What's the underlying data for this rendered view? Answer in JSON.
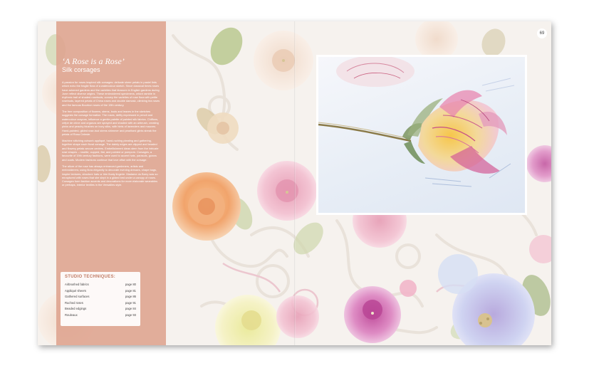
{
  "page": {
    "number": "69"
  },
  "article": {
    "title": "‘A Rose is a Rose’",
    "subtitle": "Silk corsages",
    "paragraphs": [
      "A passion for roses inspired silk corsages: delicate sheer petals in pastel tints which echo the fragile flora of a watercolour sketch. Since classical times roses have adorned gardens and the varieties that blossom in English gardens during June reflect diverse origins. These embroidered specimens, which ramble in rhythmic trail of shaded rosebuds, convey the varieties of rose flora with petite rosebuds, layered petals of China roses and double damask, climbing tea roses and the famous Bourbon roses of the 19th century.",
      "The free composition of flowers, stems, buds and leaves in the sketches suggests the corsage formation. The roses, deftly expressed in pencil and watercolour crayons, influence a gentle palette of painted silk fabrics. Chiffons, crêpe de chine and organza are sprayed and shaded with an airbrush, creating pinks and peachy blushes on ivory silks, with hints of lavenders and mauves. Hand-painted, gilded rose-bud stems shimmer and pearlised glints streak the petals of Rosa Celeste.",
      "Machine stitching cutwork appliqué, hand-ruching pleating and gathering, together shape each floral corsage. The dainty edges are clipped and beaded and flowery petals secure centres. Embellishment ideas stem from the intricate rose shapes – rosette, cupped, flat, and pointed or pompom. Corsages, a favourite of 19th century fashions, were used to accent hats, parasols, gowns and coats. Modern fashions continue that love affair with the corsage.",
      "The allure of the rose has always entranced gardeners, artists and embroiderers; using flora elegantly to decorate evening dresses, shape bags, inspire textures, structure hats or trim floaty lingerie. Madame du Barry was so enraptured with roses that she slept in a gilded bed under a canopy of roses. Corsages form fashion accents and decorations for more elaborate wearables or perhaps, interior textiles in the Versailles style."
    ]
  },
  "techniques": {
    "heading": "STUDIO TECHNIQUES:",
    "items": [
      {
        "name": "Airbrushed fabrics",
        "page": "page 80"
      },
      {
        "name": "Appliqué sheers",
        "page": "page 81"
      },
      {
        "name": "Gathered surfaces",
        "page": "page 86"
      },
      {
        "name": "Ruched roses",
        "page": "page 91"
      },
      {
        "name": "Beaded edgings",
        "page": "page 84"
      },
      {
        "name": "Rouleaux",
        "page": "page 93"
      }
    ]
  },
  "colors": {
    "panel": "#dea38e",
    "accent": "#c07a63",
    "background": "#f6f2ee"
  }
}
